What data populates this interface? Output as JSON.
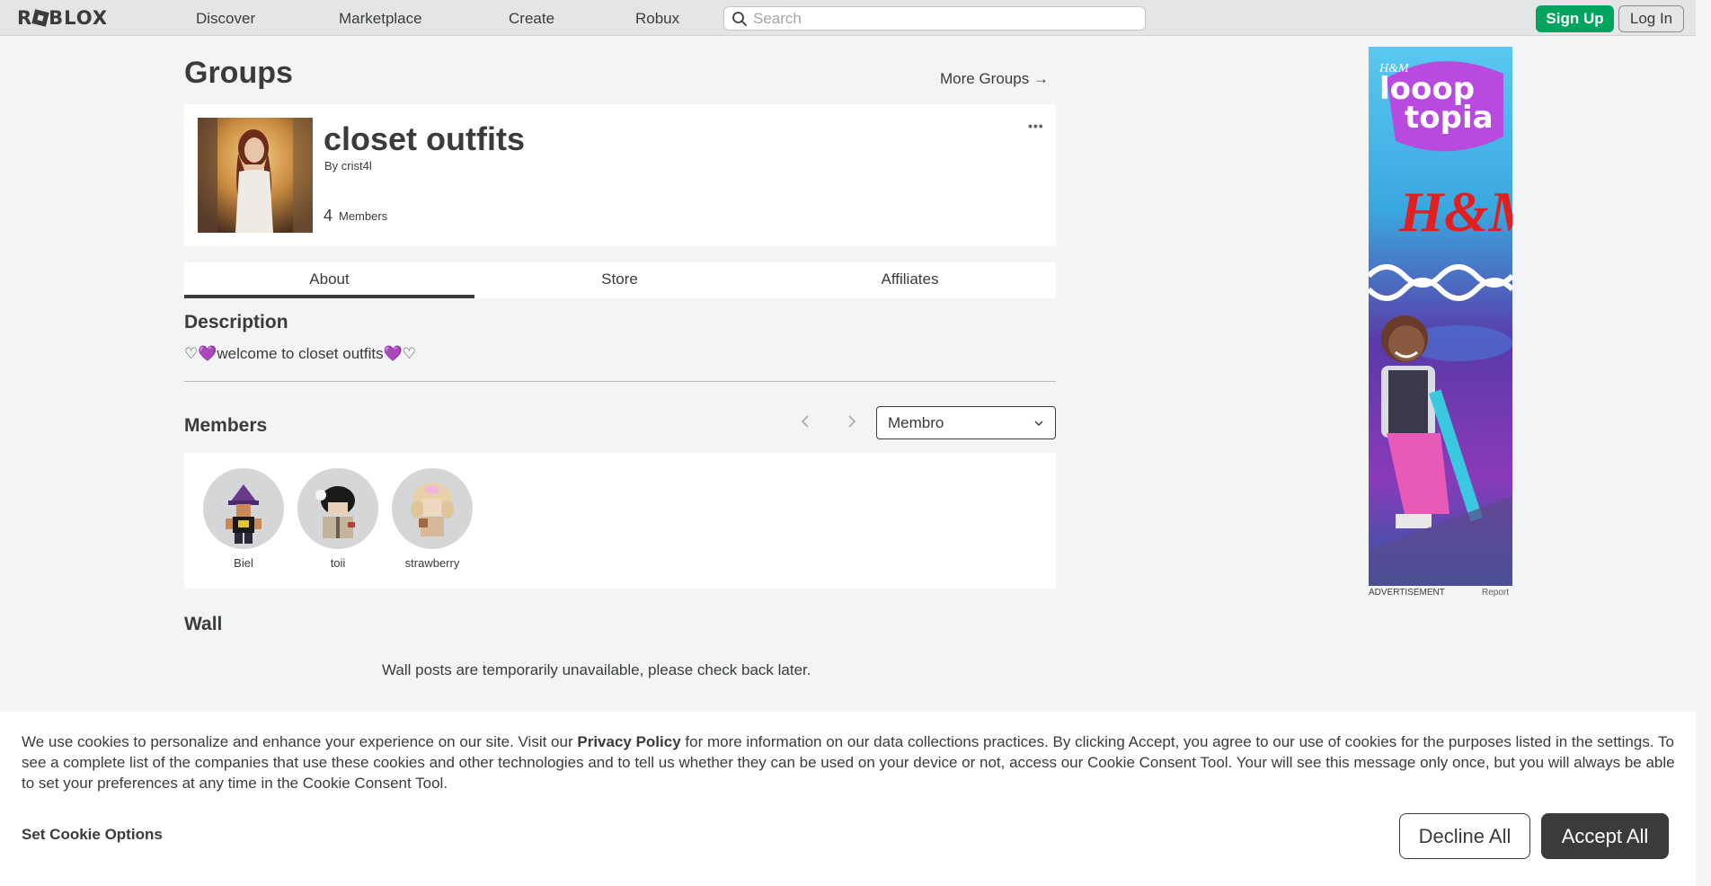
{
  "header": {
    "logo_text": "ROBLOX",
    "nav": [
      "Discover",
      "Marketplace",
      "Create",
      "Robux"
    ],
    "search_placeholder": "Search",
    "signup_label": "Sign Up",
    "login_label": "Log In"
  },
  "page": {
    "title": "Groups",
    "more_groups_label": "More Groups →"
  },
  "group": {
    "name": "closet outfits",
    "by_prefix": "By",
    "owner": "crist4l",
    "member_count": "4",
    "member_word": "Members",
    "more_icon": "•••"
  },
  "tabs": [
    "About",
    "Store",
    "Affiliates"
  ],
  "description": {
    "heading": "Description",
    "text": "♡💜welcome to closet outfits💜♡"
  },
  "members": {
    "heading": "Members",
    "role_selected": "Membro",
    "list": [
      "Biel",
      "toii",
      "strawberry"
    ]
  },
  "wall": {
    "heading": "Wall",
    "message": "Wall posts are temporarily unavailable, please check back later."
  },
  "ad": {
    "label": "ADVERTISEMENT",
    "report": "Report",
    "brand_small": "H&M",
    "title_line1": "looop",
    "title_line2": "topia",
    "brand_big": "H&M"
  },
  "cookie": {
    "text_before": "We use cookies to personalize and enhance your experience on our site. Visit our ",
    "link": "Privacy Policy",
    "text_after": " for more information on our data collections practices. By clicking Accept, you agree to our use of cookies for the purposes listed in the settings. To see a complete list of the companies that use these cookies and other technologies and to tell us whether they can be used on your device or not, access our Cookie Consent Tool. Your will see this message only once, but you will always be able to set your preferences at any time in the Cookie Consent Tool.",
    "options_label": "Set Cookie Options",
    "decline_label": "Decline All",
    "accept_label": "Accept All"
  },
  "colors": {
    "accent_green": "#00a45f",
    "text_dark": "#393b3d",
    "page_bg": "#f2f4f5",
    "topbar_bg": "#e3e5e7"
  }
}
